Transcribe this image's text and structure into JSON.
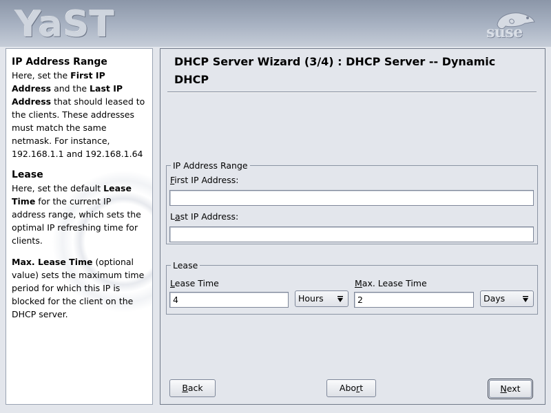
{
  "header": {
    "app_logo": "YaST",
    "brand_logo": "suse"
  },
  "help": {
    "section1_title": "IP Address Range",
    "section1_p1": "Here, set the ",
    "section1_b1": "First IP Address",
    "section1_p2": " and the ",
    "section1_b2": "Last IP Address",
    "section1_p3": " that should leased to the clients. These addresses must match the same netmask. For instance, 192.168.1.1 and 192.168.1.64",
    "section2_title": "Lease",
    "section2_p1": "Here, set the default ",
    "section2_b1": "Lease Time",
    "section2_p2": " for the current IP address range, which sets the optimal IP refreshing time for clients.",
    "section3_b1": "Max. Lease Time",
    "section3_p1": " (optional value) sets the maximum time period for which this IP is blocked for the client on the DHCP server."
  },
  "main": {
    "title": "DHCP Server Wizard (3/4) : DHCP Server -- Dynamic DHCP",
    "ip_range": {
      "legend": "IP Address Range",
      "first_label_ul": "F",
      "first_label_rest": "irst IP Address:",
      "first_value": "",
      "last_label_pre": "L",
      "last_label_ul": "a",
      "last_label_rest": "st IP Address:",
      "last_value": ""
    },
    "lease": {
      "legend": "Lease",
      "lease_time_label_ul": "L",
      "lease_time_label_rest": "ease Time",
      "lease_time_value": "4",
      "lease_unit": "Hours",
      "max_label_ul": "M",
      "max_label_rest": "ax. Lease Time",
      "max_value": "2",
      "max_unit": "Days"
    }
  },
  "buttons": {
    "back_ul": "B",
    "back_rest": "ack",
    "abort_pre": "Abo",
    "abort_ul": "r",
    "abort_rest": "t",
    "next_ul": "N",
    "next_rest": "ext"
  }
}
